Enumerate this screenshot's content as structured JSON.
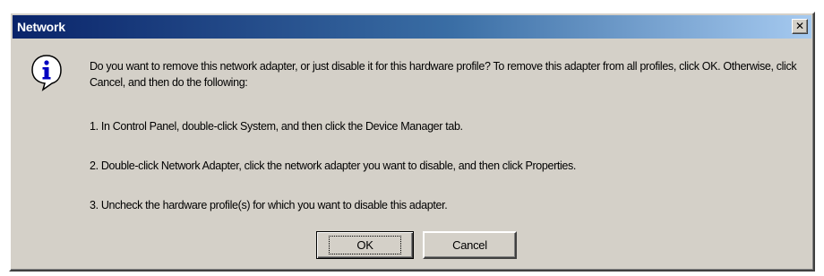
{
  "window": {
    "title": "Network",
    "close_glyph": "✕"
  },
  "icon": {
    "name": "info-icon",
    "glyph": "i"
  },
  "message": {
    "intro": "Do you want to remove this network adapter, or just disable it for this hardware profile?  To remove this adapter from all profiles, click OK.  Otherwise, click Cancel, and then do the following:",
    "steps": [
      "1.  In Control Panel, double-click System, and then click the Device Manager tab.",
      "2.  Double-click Network Adapter, click the network adapter you want to disable, and then click Properties.",
      "3.  Uncheck the hardware profile(s) for which you want to disable this adapter."
    ]
  },
  "buttons": {
    "ok": "OK",
    "cancel": "Cancel"
  }
}
